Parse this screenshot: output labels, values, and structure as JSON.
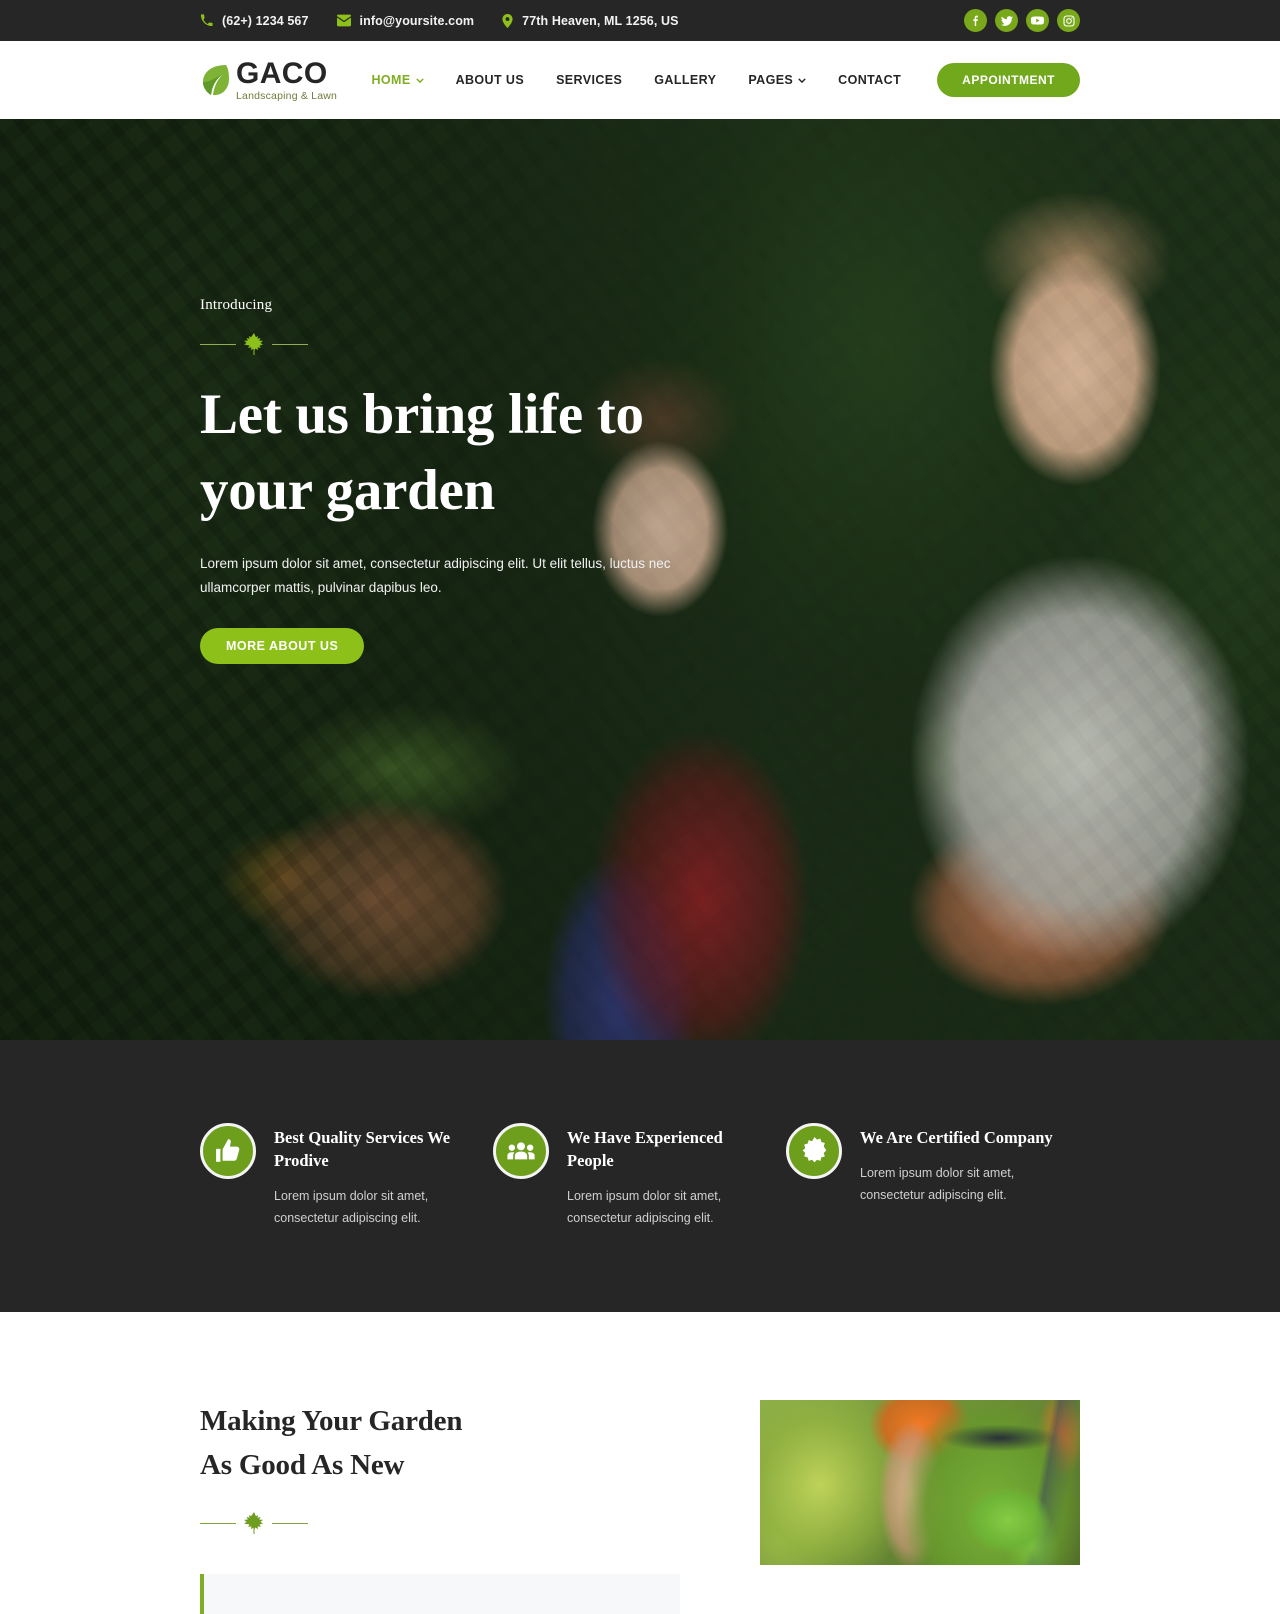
{
  "topbar": {
    "phone": "(62+) 1234 567",
    "email": "info@yoursite.com",
    "address": "77th Heaven, ML 1256, US",
    "socials": [
      {
        "name": "facebook-icon",
        "label": "Facebook"
      },
      {
        "name": "twitter-icon",
        "label": "Twitter"
      },
      {
        "name": "youtube-icon",
        "label": "YouTube"
      },
      {
        "name": "instagram-icon",
        "label": "Instagram"
      }
    ]
  },
  "header": {
    "brand_name": "GACO",
    "brand_tagline": "Landscaping & Lawn",
    "nav": [
      {
        "label": "HOME",
        "active": true,
        "has_dropdown": true
      },
      {
        "label": "ABOUT US",
        "active": false,
        "has_dropdown": false
      },
      {
        "label": "SERVICES",
        "active": false,
        "has_dropdown": false
      },
      {
        "label": "GALLERY",
        "active": false,
        "has_dropdown": false
      },
      {
        "label": "PAGES",
        "active": false,
        "has_dropdown": true
      },
      {
        "label": "CONTACT",
        "active": false,
        "has_dropdown": false
      }
    ],
    "appointment_label": "APPOINTMENT"
  },
  "hero": {
    "eyebrow": "Introducing",
    "title_line1": "Let us bring life to",
    "title_line2": "your garden",
    "description": "Lorem ipsum dolor sit amet, consectetur adipiscing elit. Ut elit tellus, luctus nec ullamcorper mattis, pulvinar dapibus leo.",
    "cta_label": "MORE ABOUT US"
  },
  "features": [
    {
      "icon": "thumbs-up-icon",
      "title": "Best Quality Services We Prodive",
      "description": "Lorem ipsum dolor sit amet, consectetur adipiscing elit."
    },
    {
      "icon": "people-group-icon",
      "title": "We Have Experienced People",
      "description": "Lorem ipsum dolor sit amet, consectetur adipiscing elit."
    },
    {
      "icon": "certified-badge-icon",
      "title": "We Are Certified Company",
      "description": "Lorem ipsum dolor sit amet, consectetur adipiscing elit."
    }
  ],
  "about": {
    "title_line1": "Making Your Garden",
    "title_line2": "As Good As New",
    "quote": ""
  },
  "colors": {
    "brand_green": "#72a81c",
    "bright_green": "#8ec01a",
    "accent_green": "#7fae22",
    "social_green": "#79a81b",
    "dark_bg": "#262626",
    "white": "#ffffff"
  }
}
